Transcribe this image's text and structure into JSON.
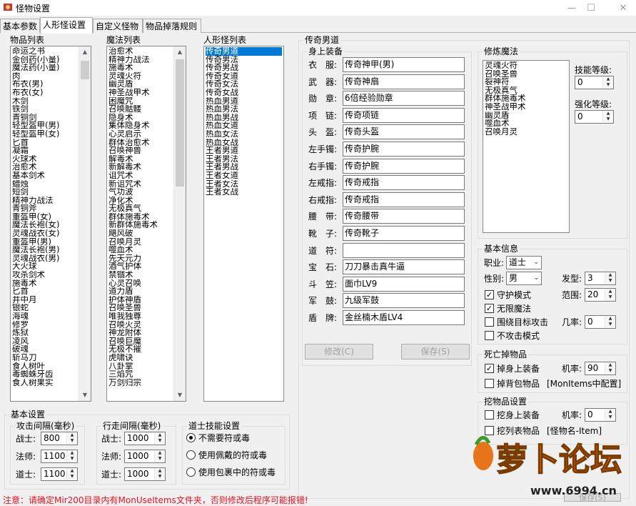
{
  "window": {
    "title": "怪物设置",
    "minimize": "—",
    "maximize": "☐",
    "close": "✕"
  },
  "tabs": [
    "基本参数",
    "人形怪设置",
    "自定义怪物",
    "物品掉落规则"
  ],
  "item_list": {
    "title": "物品列表",
    "items": [
      "命运之书",
      "金创药(小量)",
      "魔法药(小量)",
      "肉",
      "布衣(男)",
      "布衣(女)",
      "木剑",
      "铁剑",
      "青铜剑",
      "轻型盔甲(男)",
      "轻型盔甲(女)",
      "匕首",
      "凝霜",
      "火球术",
      "治愈术",
      "基本剑术",
      "蜡烛",
      "短剑",
      "精神力战法",
      "青铜斧",
      "重盔甲(女)",
      "魔法长袍(女)",
      "灵魂战衣(女)",
      "重盔甲(男)",
      "魔法长袍(男)",
      "灵魂战衣(男)",
      "大火球",
      "攻杀剑术",
      "施毒术",
      "匕首",
      "井中月",
      "银蛇",
      "海魂",
      "修罗",
      "炼狱",
      "凌风",
      "破魂",
      "斩马刀",
      "食人树叶",
      "毒蜘蛛牙齿",
      "食人树果实"
    ]
  },
  "magic_list": {
    "title": "魔法列表",
    "items": [
      "治愈术",
      "精神力战法",
      "施毒术",
      "灵魂火符",
      "幽灵盾",
      "神圣战甲术",
      "困魔咒",
      "召唤骷髅",
      "隐身术",
      "集体隐身术",
      "心灵启示",
      "群体治愈术",
      "召唤神兽",
      "解毒术",
      "新解毒术",
      "诅咒术",
      "新诅咒术",
      "气功波",
      "净化术",
      "无极真气",
      "群体施毒术",
      "新群体施毒术",
      "飓风破",
      "召唤月灵",
      "噬血术",
      "先天元力",
      "酒气护体",
      "禁锢术",
      "心灵召唤",
      "道力盾",
      "护体神盾",
      "召唤圣兽",
      "唯我独尊",
      "召唤火灵",
      "神龙附体",
      "召唤巨魔",
      "无极不摧",
      "虎啸诀",
      "八卦掌",
      "三焰咒",
      "万剑归宗"
    ]
  },
  "humanoid_list": {
    "title": "人形怪列表",
    "selected_index": 0,
    "items": [
      "传奇男道",
      "传奇男法",
      "传奇男战",
      "传奇女道",
      "传奇女法",
      "传奇女战",
      "热血男道",
      "热血男法",
      "热血男战",
      "热血女道",
      "热血女法",
      "热血女战",
      "王者男道",
      "王者男法",
      "王者男战",
      "王者女道",
      "王者女法",
      "王者女战"
    ]
  },
  "detail": {
    "title": "传奇男道",
    "equip": {
      "title": "身上装备",
      "rows": [
        {
          "label": "衣　服:",
          "value": "传奇神甲(男)"
        },
        {
          "label": "武　器:",
          "value": "传奇神扇"
        },
        {
          "label": "勋　章:",
          "value": "6倍经验勋章"
        },
        {
          "label": "项　链:",
          "value": "传奇项链"
        },
        {
          "label": "头　盔:",
          "value": "传奇头盔"
        },
        {
          "label": "左手镯:",
          "value": "传奇护腕"
        },
        {
          "label": "右手镯:",
          "value": "传奇护腕"
        },
        {
          "label": "左戒指:",
          "value": "传奇戒指"
        },
        {
          "label": "右戒指:",
          "value": "传奇戒指"
        },
        {
          "label": "腰　带:",
          "value": "传奇腰带"
        },
        {
          "label": "靴　子:",
          "value": "传奇靴子"
        },
        {
          "label": "道　符:",
          "value": ""
        },
        {
          "label": "宝　石:",
          "value": "刀刀暴击真牛逼"
        },
        {
          "label": "斗　笠:",
          "value": "面巾LV9"
        },
        {
          "label": "军　鼓:",
          "value": "九级军鼓"
        },
        {
          "label": "盾　牌:",
          "value": "金丝楠木盾LV4"
        }
      ],
      "modify_button": "修改(C)",
      "save_button": "保存(S)"
    },
    "magic": {
      "title": "修炼魔法",
      "items": [
        "灵魂火符",
        "召唤圣兽",
        "裂神符",
        "无极真气",
        "群体施毒术",
        "神圣战甲术",
        "幽灵盾",
        "噬血术",
        "召唤月灵"
      ],
      "skill_level_label": "技能等级:",
      "skill_level": "0",
      "strength_level_label": "强化等级:",
      "strength_level": "0"
    },
    "basic": {
      "title": "基本信息",
      "job_label": "职业:",
      "job": "道士",
      "gender_label": "性别:",
      "gender": "男",
      "hair_label": "发型:",
      "hair": "3",
      "range_label": "范围:",
      "range": "20",
      "chance_label": "几率:",
      "chance": "0",
      "guard_mode": "守护模式",
      "guard_checked": true,
      "unlimited_magic": "无限魔法",
      "unlimited_checked": true,
      "around_attack": "围绕目标攻击",
      "around_checked": false,
      "no_attack": "不攻击模式",
      "no_attack_checked": false
    },
    "death_drop": {
      "title": "死亡掉物品",
      "drop_equip": "掉身上装备",
      "drop_equip_checked": true,
      "chance_label": "机率:",
      "chance": "90",
      "drop_bag": "掉背包物品",
      "drop_bag_checked": false,
      "bag_note": "[MonItems中配置]"
    },
    "dig": {
      "title": "挖物品设置",
      "dig_equip": "挖身上装备",
      "dig_equip_checked": false,
      "chance_label": "机率:",
      "chance": "0",
      "dig_list": "挖列表物品",
      "dig_list_checked": false,
      "list_note": "[怪物名-Item]"
    },
    "save_bottom": "保存(S)"
  },
  "basic_settings": {
    "title": "基本设置",
    "attack": {
      "title": "攻击间隔(毫秒)",
      "rows": [
        {
          "label": "战士:",
          "value": "800"
        },
        {
          "label": "法师:",
          "value": "1100"
        },
        {
          "label": "道士:",
          "value": "1100"
        }
      ]
    },
    "walk": {
      "title": "行走间隔(毫秒)",
      "rows": [
        {
          "label": "战士:",
          "value": "1000"
        },
        {
          "label": "法师:",
          "value": "1000"
        },
        {
          "label": "道士:",
          "value": "1000"
        }
      ]
    },
    "taoist": {
      "title": "道士技能设置",
      "options": [
        "不需要符或毒",
        "使用佩戴的符或毒",
        "使用包裹中的符或毒"
      ],
      "selected": 0
    }
  },
  "footer_note": "注意：请确定Mir200目录内有MonUseItems文件夹，否则修改后程序可能报错!",
  "watermark": {
    "text": "萝卜论坛",
    "url": "www.6994.cn"
  },
  "colors": {
    "selection": "#0078d7",
    "note": "#e81123",
    "watermark": "#e8751a"
  }
}
